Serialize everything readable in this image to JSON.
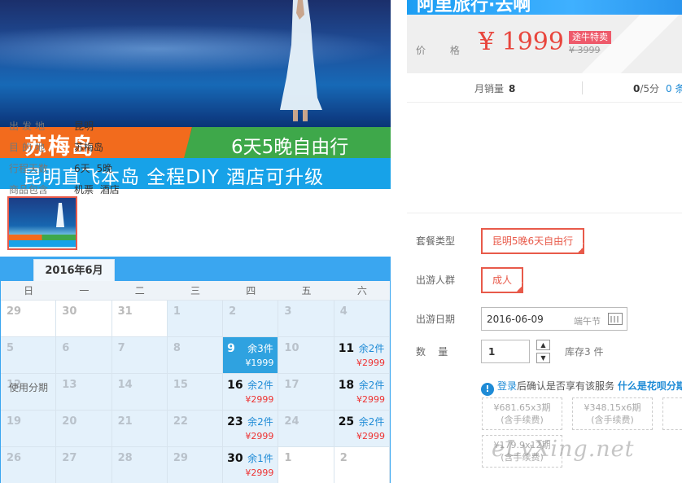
{
  "banner": {
    "name": "苏梅岛",
    "days": "6天5晚自由行",
    "slogan": "昆明直飞本岛  全程DIY 酒店可升级"
  },
  "header": {
    "title": "阿里旅行·去啊"
  },
  "price": {
    "label": "价  格",
    "value": "¥ 1999",
    "tag": "途牛特卖",
    "original": "¥ 3999"
  },
  "stats": {
    "sold_label": "月销量",
    "sold_value": "8",
    "score_value": "0",
    "score_suffix": "/5分",
    "extra": "0 条"
  },
  "info": [
    {
      "key": "出发地",
      "value": "昆明"
    },
    {
      "key": "目的地",
      "value": "苏梅岛"
    },
    {
      "key": "行程天数",
      "value": "6天 5晚"
    },
    {
      "key": "商品包含",
      "value": "机票  酒店"
    }
  ],
  "options": {
    "package_label": "套餐类型",
    "package_value": "昆明5晚6天自由行",
    "crowd_label": "出游人群",
    "crowd_value": "成人",
    "date_label": "出游日期",
    "date_value": "2016-06-09",
    "date_festival": "端午节",
    "qty_label": "数    量",
    "qty_value": "1",
    "stock_text": "库存3 件"
  },
  "installment": {
    "label": "使用分期",
    "login": "登录",
    "mid": "后确认是否享有该服务",
    "what": "什么是花呗分期",
    "plans": [
      {
        "amount": "¥681.65x3期",
        "fee": "(含手续费)"
      },
      {
        "amount": "¥348.15x6期",
        "fee": "(含手续费)"
      },
      {
        "amount": "¥179.9x12期",
        "fee": "(含手续费)"
      }
    ]
  },
  "calendar": {
    "month": "2016年6月",
    "weekdays": [
      "日",
      "一",
      "二",
      "三",
      "四",
      "五",
      "六"
    ],
    "rows": [
      [
        {
          "d": "29",
          "t": "white"
        },
        {
          "d": "30",
          "t": "white"
        },
        {
          "d": "31",
          "t": "white"
        },
        {
          "d": "1"
        },
        {
          "d": "2"
        },
        {
          "d": "3"
        },
        {
          "d": "4"
        }
      ],
      [
        {
          "d": "5"
        },
        {
          "d": "6"
        },
        {
          "d": "7"
        },
        {
          "d": "8"
        },
        {
          "d": "9",
          "t": "sel",
          "stock": "余3件",
          "price": "¥1999"
        },
        {
          "d": "10"
        },
        {
          "d": "11",
          "t": "has",
          "stock": "余2件",
          "price": "¥2999"
        }
      ],
      [
        {
          "d": "12"
        },
        {
          "d": "13"
        },
        {
          "d": "14"
        },
        {
          "d": "15"
        },
        {
          "d": "16",
          "t": "has",
          "stock": "余2件",
          "price": "¥2999"
        },
        {
          "d": "17"
        },
        {
          "d": "18",
          "t": "has",
          "stock": "余2件",
          "price": "¥2999"
        }
      ],
      [
        {
          "d": "19"
        },
        {
          "d": "20"
        },
        {
          "d": "21"
        },
        {
          "d": "22"
        },
        {
          "d": "23",
          "t": "has",
          "stock": "余2件",
          "price": "¥2999"
        },
        {
          "d": "24"
        },
        {
          "d": "25",
          "t": "has",
          "stock": "余2件",
          "price": "¥2999"
        }
      ],
      [
        {
          "d": "26"
        },
        {
          "d": "27"
        },
        {
          "d": "28"
        },
        {
          "d": "29"
        },
        {
          "d": "30",
          "t": "has",
          "stock": "余1件",
          "price": "¥2999"
        },
        {
          "d": "1",
          "t": "white"
        },
        {
          "d": "2",
          "t": "white"
        }
      ]
    ]
  },
  "watermark": "eLvXing.net"
}
